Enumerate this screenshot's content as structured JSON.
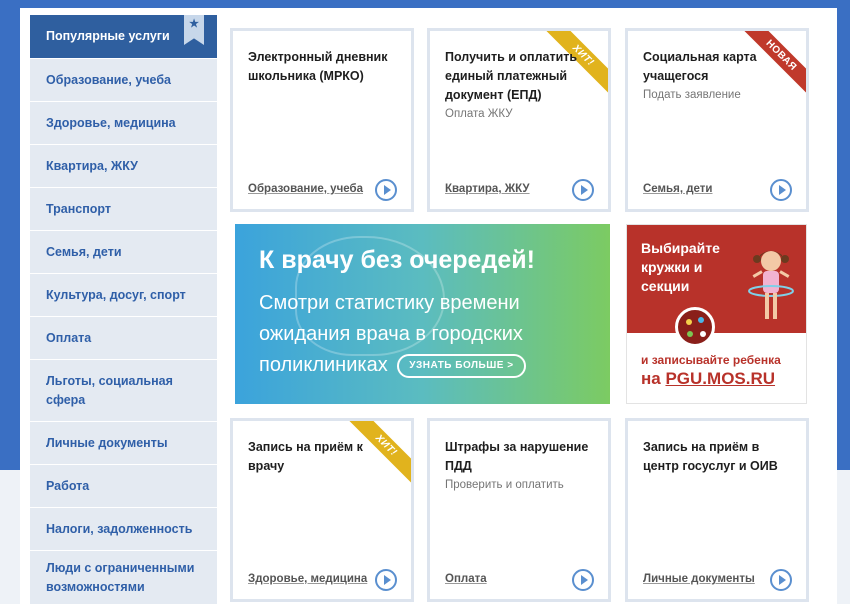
{
  "sidebar": {
    "items": [
      {
        "label": "Популярные услуги",
        "active": true
      },
      {
        "label": "Образование, учеба"
      },
      {
        "label": "Здоровье, медицина"
      },
      {
        "label": "Квартира, ЖКУ"
      },
      {
        "label": "Транспорт"
      },
      {
        "label": "Семья, дети"
      },
      {
        "label": "Культура, досуг, спорт"
      },
      {
        "label": "Оплата"
      },
      {
        "label": "Льготы, социальная сфера"
      },
      {
        "label": "Личные документы"
      },
      {
        "label": "Работа"
      },
      {
        "label": "Налоги, задолженность"
      },
      {
        "label": "Люди с ограниченными возможностями"
      }
    ],
    "star_icon": "★"
  },
  "cards": [
    {
      "title": "Электронный дневник школьника (МРКО)",
      "sub": "",
      "category": "Образование, учеба",
      "ribbon": ""
    },
    {
      "title": "Получить и оплатить единый платежный документ (ЕПД)",
      "sub": "Оплата ЖКУ",
      "category": "Квартира, ЖКУ",
      "ribbon": "ХИТ!"
    },
    {
      "title": "Социальная карта учащегося",
      "sub": "Подать заявление",
      "category": "Семья, дети",
      "ribbon": "НОВАЯ"
    },
    {
      "title": "Запись на приём к врачу",
      "sub": "",
      "category": "Здоровье, медицина",
      "ribbon": "ХИТ!"
    },
    {
      "title": "Штрафы за нарушение ПДД",
      "sub": "Проверить и оплатить",
      "category": "Оплата",
      "ribbon": ""
    },
    {
      "title": "Запись на приём в центр госуслуг и ОИВ",
      "sub": "",
      "category": "Личные документы",
      "ribbon": ""
    }
  ],
  "banner_main": {
    "headline": "К врачу без очередей!",
    "text": "Смотри статистику времени ожидания врача в городских поликлиниках",
    "button": "УЗНАТЬ БОЛЬШЕ >"
  },
  "banner_side": {
    "line1": "Выбирайте кружки и секции",
    "line2": "и записывайте ребенка",
    "line3_prefix": "на",
    "line3_site": "PGU.MOS.RU"
  },
  "colors": {
    "accent": "#2f5f9f",
    "sidebar_bg": "#e4eaf2",
    "hit": "#e1b31d",
    "new": "#c0392b"
  }
}
